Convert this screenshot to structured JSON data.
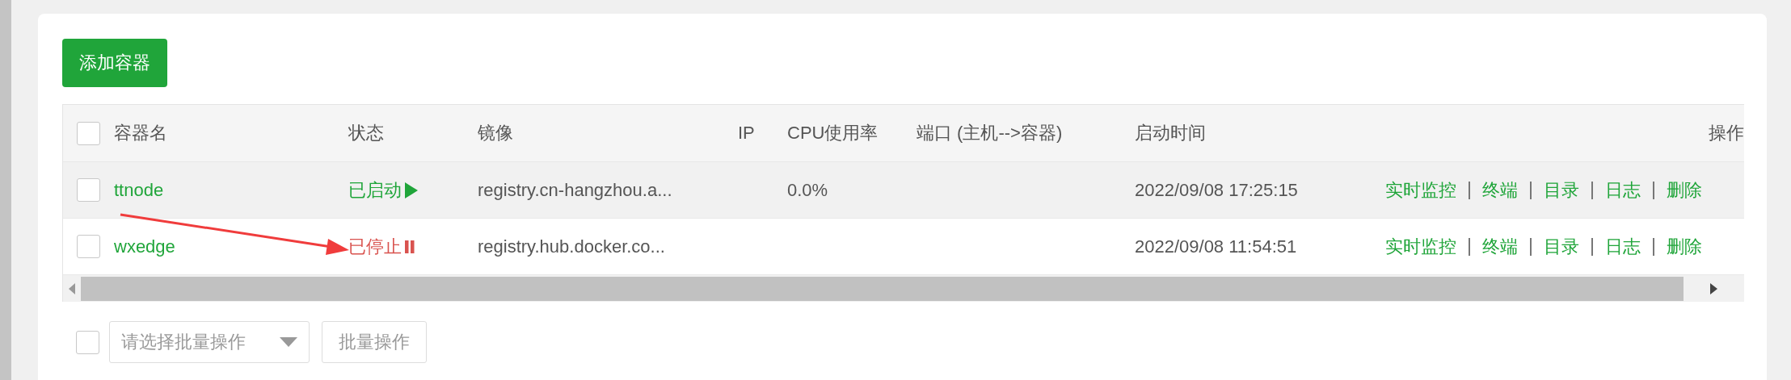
{
  "toolbar": {
    "add_button": "添加容器"
  },
  "table": {
    "header_checkbox": {
      "checked": false
    },
    "columns": [
      "容器名",
      "状态",
      "镜像",
      "IP",
      "CPU使用率",
      "端口 (主机-->容器)",
      "启动时间",
      "操作"
    ],
    "rows": [
      {
        "checked": false,
        "highlighted": true,
        "name": "ttnode",
        "status": {
          "text": "已启动",
          "kind": "running"
        },
        "image": "registry.cn-hangzhou.a...",
        "ip": "",
        "cpu": "0.0%",
        "ports": "",
        "started": "2022/09/08 17:25:15",
        "actions": [
          "实时监控",
          "终端",
          "目录",
          "日志",
          "删除"
        ]
      },
      {
        "checked": false,
        "highlighted": false,
        "name": "wxedge",
        "status": {
          "text": "已停止",
          "kind": "stopped"
        },
        "image": "registry.hub.docker.co...",
        "ip": "",
        "cpu": "",
        "ports": "",
        "started": "2022/09/08 11:54:51",
        "actions": [
          "实时监控",
          "终端",
          "目录",
          "日志",
          "删除"
        ]
      }
    ]
  },
  "batch": {
    "checkbox": {
      "checked": false
    },
    "select": {
      "placeholder": "请选择批量操作"
    },
    "apply_button": {
      "label": "批量操作",
      "disabled": true
    }
  }
}
